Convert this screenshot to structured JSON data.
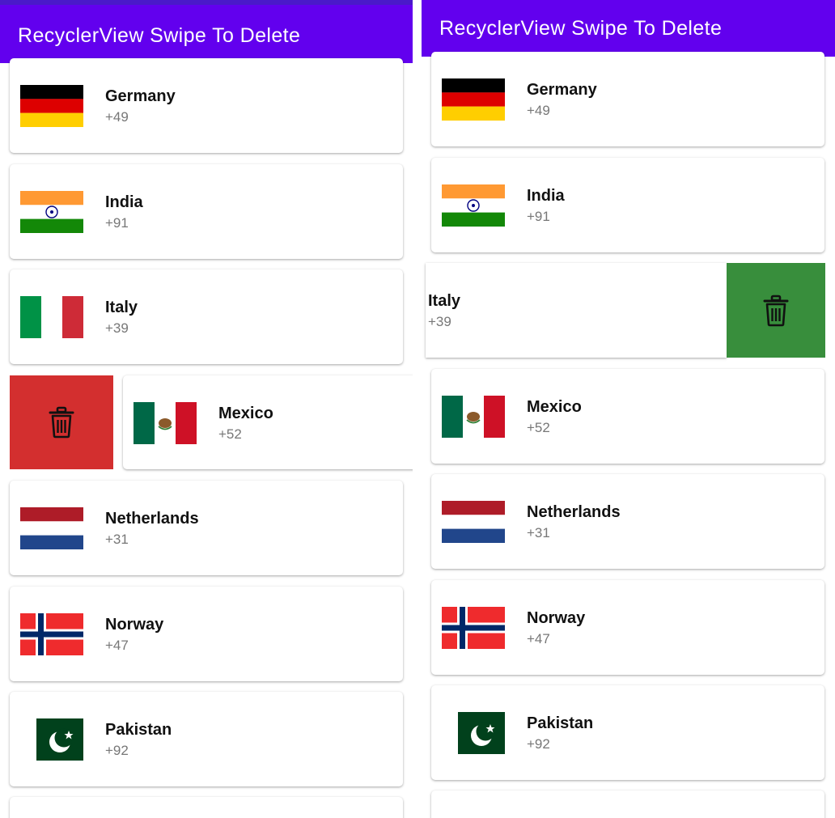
{
  "app": {
    "title": "RecyclerView Swipe To Delete"
  },
  "colors": {
    "app_bar": "#6200ee",
    "delete_left": "#d32f2f",
    "delete_right": "#388e3c"
  },
  "icons": {
    "delete": "trash-icon"
  },
  "panels": {
    "left": {
      "swipe_state": "Mexico row swiped right revealing delete action",
      "items": [
        {
          "name": "Germany",
          "code": "+49"
        },
        {
          "name": "India",
          "code": "+91"
        },
        {
          "name": "Italy",
          "code": "+39"
        },
        {
          "name": "Mexico",
          "code": "+52"
        },
        {
          "name": "Netherlands",
          "code": "+31"
        },
        {
          "name": "Norway",
          "code": "+47"
        },
        {
          "name": "Pakistan",
          "code": "+92"
        }
      ]
    },
    "right": {
      "swipe_state": "Italy row swiped left revealing delete action",
      "items": [
        {
          "name": "Germany",
          "code": "+49"
        },
        {
          "name": "India",
          "code": "+91"
        },
        {
          "name": "Italy",
          "code": "+39"
        },
        {
          "name": "Mexico",
          "code": "+52"
        },
        {
          "name": "Netherlands",
          "code": "+31"
        },
        {
          "name": "Norway",
          "code": "+47"
        },
        {
          "name": "Pakistan",
          "code": "+92"
        }
      ]
    }
  }
}
